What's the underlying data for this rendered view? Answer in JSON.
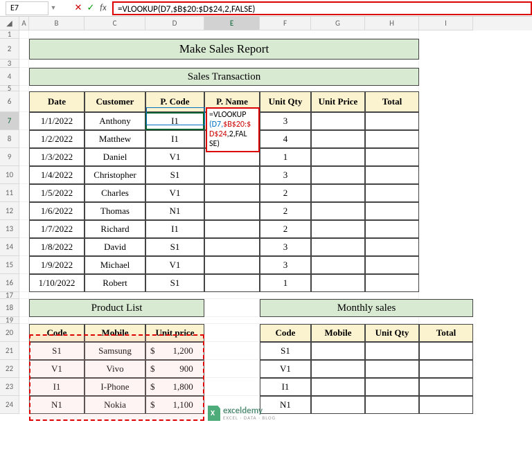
{
  "nameBox": "E7",
  "formula": "=VLOOKUP(D7,$B$20:$D$24,2,FALSE)",
  "editingText": {
    "l1": "=VLOOKUP",
    "l2a": "(D7,",
    "l2b": "$B$20:$",
    "l3a": "D$24",
    "l3b": ",2,FAL",
    "l4": "SE)"
  },
  "columns": [
    "A",
    "B",
    "C",
    "D",
    "E",
    "F",
    "G",
    "H",
    "I"
  ],
  "rowLabels": [
    "1",
    "2",
    "3",
    "4",
    "5",
    "6",
    "7",
    "8",
    "9",
    "10",
    "11",
    "12",
    "13",
    "14",
    "15",
    "16",
    "17",
    "18",
    "19",
    "20",
    "21",
    "22",
    "23",
    "24"
  ],
  "titles": {
    "main": "Make Sales Report",
    "sales": "Sales Transaction",
    "product": "Product List",
    "monthly": "Monthly sales"
  },
  "salesHdr": {
    "date": "Date",
    "cust": "Customer",
    "pcode": "P. Code",
    "pname": "P. Name",
    "uqty": "Unit Qty",
    "uprice": "Unit Price",
    "total": "Total"
  },
  "salesRows": [
    {
      "date": "1/1/2022",
      "cust": "Anthony",
      "pcode": "I1",
      "pname": "",
      "uqty": "3",
      "uprice": "",
      "total": ""
    },
    {
      "date": "1/2/2022",
      "cust": "Matthew",
      "pcode": "I1",
      "pname": "",
      "uqty": "4",
      "uprice": "",
      "total": ""
    },
    {
      "date": "1/3/2022",
      "cust": "Daniel",
      "pcode": "V1",
      "pname": "",
      "uqty": "1",
      "uprice": "",
      "total": ""
    },
    {
      "date": "1/4/2022",
      "cust": "Christopher",
      "pcode": "S1",
      "pname": "",
      "uqty": "3",
      "uprice": "",
      "total": ""
    },
    {
      "date": "1/5/2022",
      "cust": "Charles",
      "pcode": "V1",
      "pname": "",
      "uqty": "2",
      "uprice": "",
      "total": ""
    },
    {
      "date": "1/6/2022",
      "cust": "Thomas",
      "pcode": "N1",
      "pname": "",
      "uqty": "2",
      "uprice": "",
      "total": ""
    },
    {
      "date": "1/7/2022",
      "cust": "Richard",
      "pcode": "I1",
      "pname": "",
      "uqty": "2",
      "uprice": "",
      "total": ""
    },
    {
      "date": "1/8/2022",
      "cust": "David",
      "pcode": "S1",
      "pname": "",
      "uqty": "3",
      "uprice": "",
      "total": ""
    },
    {
      "date": "1/9/2022",
      "cust": "Michael",
      "pcode": "V1",
      "pname": "",
      "uqty": "3",
      "uprice": "",
      "total": ""
    },
    {
      "date": "1/10/2022",
      "cust": "Robert",
      "pcode": "S1",
      "pname": "",
      "uqty": "1",
      "uprice": "",
      "total": ""
    }
  ],
  "prodHdr": {
    "code": "Code",
    "mobile": "Mobile",
    "price": "Unit price"
  },
  "prodRows": [
    {
      "code": "S1",
      "mobile": "Samsung",
      "price": "$        1,200"
    },
    {
      "code": "V1",
      "mobile": "Vivo",
      "price": "$           900"
    },
    {
      "code": "I1",
      "mobile": "I-Phone",
      "price": "$        1,800"
    },
    {
      "code": "N1",
      "mobile": "Nokia",
      "price": "$        1,100"
    }
  ],
  "monthHdr": {
    "code": "Code",
    "mobile": "Mobile",
    "uqty": "Unit Qty",
    "total": "Total"
  },
  "monthRows": [
    {
      "code": "S1",
      "mobile": "",
      "uqty": "",
      "total": ""
    },
    {
      "code": "V1",
      "mobile": "",
      "uqty": "",
      "total": ""
    },
    {
      "code": "I1",
      "mobile": "",
      "uqty": "",
      "total": ""
    },
    {
      "code": "N1",
      "mobile": "",
      "uqty": "",
      "total": ""
    }
  ],
  "watermark": {
    "brand": "exceldemy",
    "sub": "EXCEL · DATA · BLOG"
  }
}
